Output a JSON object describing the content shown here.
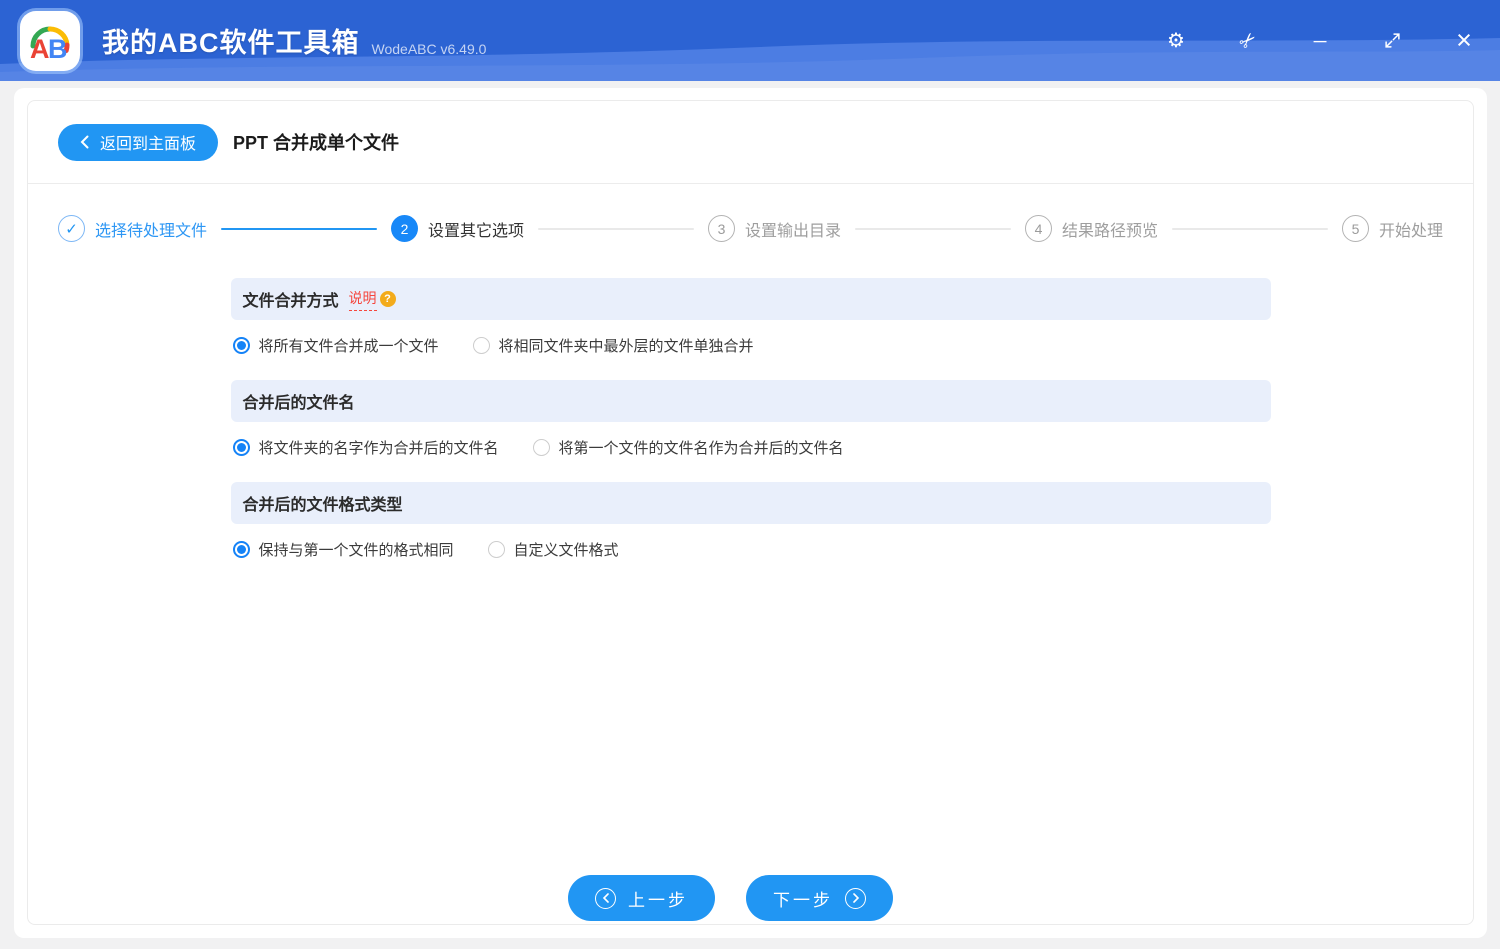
{
  "titlebar": {
    "logo": {
      "letter_a": "A",
      "letter_b": "B"
    },
    "app_title": "我的ABC软件工具箱",
    "version": "WodeABC v6.49.0",
    "icons": {
      "settings": "⚙",
      "scissors": "✂",
      "minimize": "─",
      "maximize": "diagonal-resize-arrows",
      "close": "×"
    }
  },
  "header": {
    "back_label": "返回到主面板",
    "page_title": "PPT 合并成单个文件"
  },
  "steps": [
    {
      "mark": "✓",
      "label": "选择待处理文件",
      "state": "done"
    },
    {
      "mark": "2",
      "label": "设置其它选项",
      "state": "active"
    },
    {
      "mark": "3",
      "label": "设置输出目录",
      "state": "pending"
    },
    {
      "mark": "4",
      "label": "结果路径预览",
      "state": "pending"
    },
    {
      "mark": "5",
      "label": "开始处理",
      "state": "pending"
    }
  ],
  "connectors": [
    "done",
    "pending",
    "pending",
    "pending"
  ],
  "sections": [
    {
      "title": "文件合并方式",
      "help": "说明",
      "options": [
        {
          "label": "将所有文件合并成一个文件",
          "selected": true
        },
        {
          "label": "将相同文件夹中最外层的文件单独合并",
          "selected": false
        }
      ]
    },
    {
      "title": "合并后的文件名",
      "options": [
        {
          "label": "将文件夹的名字作为合并后的文件名",
          "selected": true
        },
        {
          "label": "将第一个文件的文件名作为合并后的文件名",
          "selected": false
        }
      ]
    },
    {
      "title": "合并后的文件格式类型",
      "options": [
        {
          "label": "保持与第一个文件的格式相同",
          "selected": true
        },
        {
          "label": "自定义文件格式",
          "selected": false
        }
      ]
    }
  ],
  "footer": {
    "prev_label": "上一步",
    "next_label": "下一步"
  },
  "colors": {
    "accent": "#2196f3",
    "titlebar": "#2c63d3",
    "titlebar_wave": "#4c7de3",
    "section_bg": "#e9effb",
    "help_red": "#f5463d",
    "help_badge": "#f3ab1b"
  }
}
